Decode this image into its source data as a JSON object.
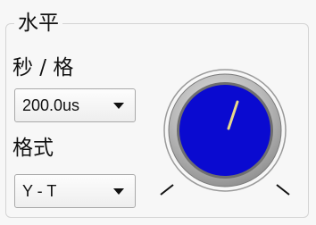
{
  "group": {
    "title": "水平"
  },
  "timebase": {
    "label": "秒 / 格",
    "value": "200.0us"
  },
  "format": {
    "label": "格式",
    "value": "Y - T"
  },
  "knob": {
    "face_color": "#0a0ad0",
    "indicator_color": "#e8d98a"
  }
}
